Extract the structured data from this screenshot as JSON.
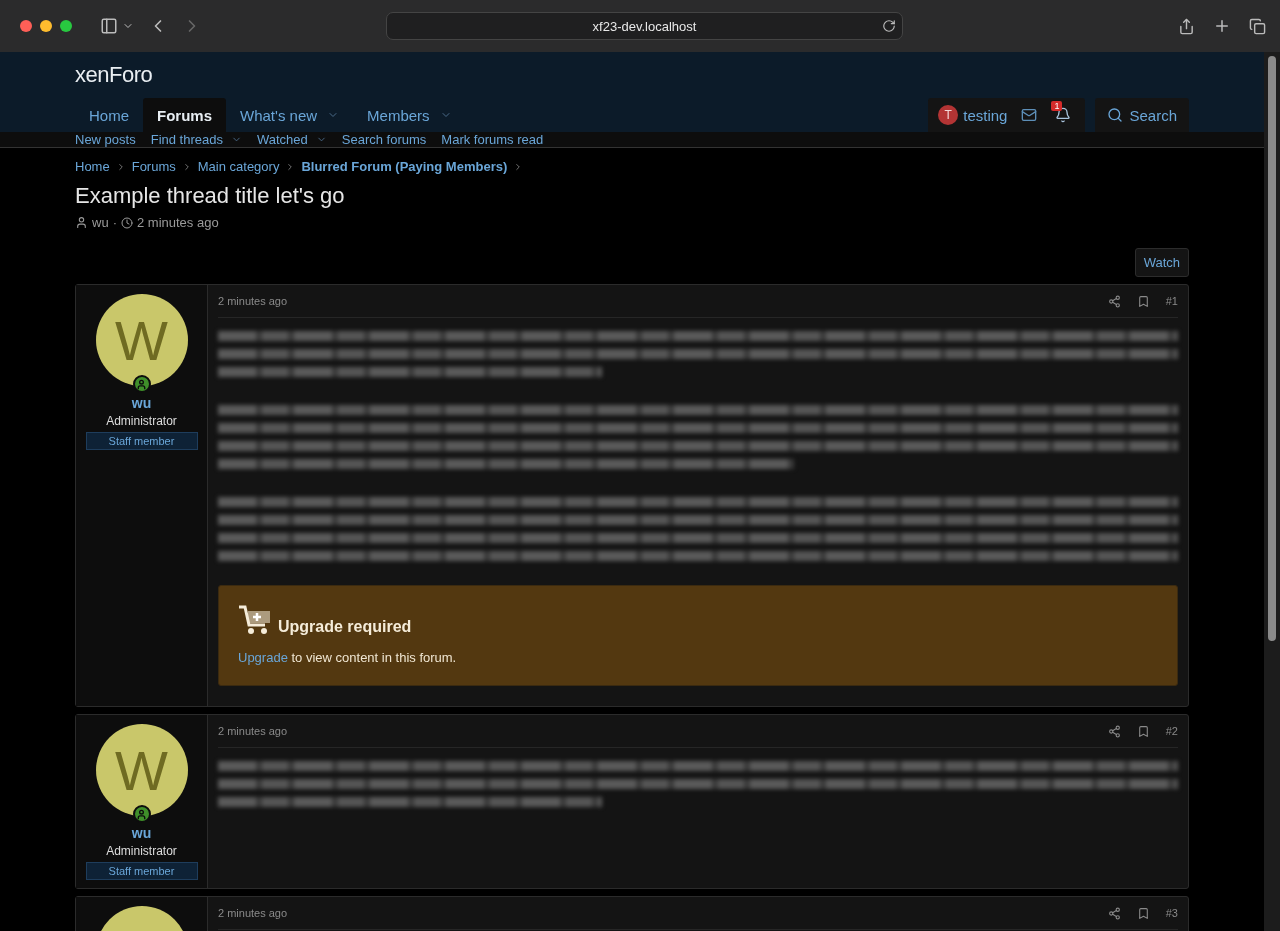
{
  "browser": {
    "url": "xf23-dev.localhost"
  },
  "logo": "xenForo",
  "nav": {
    "tabs": [
      {
        "label": "Home",
        "selected": false,
        "has_menu": false
      },
      {
        "label": "Forums",
        "selected": true,
        "has_menu": false
      },
      {
        "label": "What's new",
        "selected": false,
        "has_menu": true
      },
      {
        "label": "Members",
        "selected": false,
        "has_menu": true
      }
    ],
    "user": {
      "avatar_letter": "T",
      "name": "testing",
      "alert_count": "1"
    },
    "search_label": "Search"
  },
  "subnav": [
    {
      "label": "New posts",
      "has_menu": false
    },
    {
      "label": "Find threads",
      "has_menu": true
    },
    {
      "label": "Watched",
      "has_menu": true
    },
    {
      "label": "Search forums",
      "has_menu": false
    },
    {
      "label": "Mark forums read",
      "has_menu": false
    }
  ],
  "breadcrumbs": [
    {
      "label": "Home",
      "current": false
    },
    {
      "label": "Forums",
      "current": false
    },
    {
      "label": "Main category",
      "current": false
    },
    {
      "label": "Blurred Forum (Paying Members)",
      "current": true
    }
  ],
  "thread": {
    "title": "Example thread title let's go",
    "author": "wu",
    "separator": "·",
    "time": "2 minutes ago"
  },
  "watch_button": "Watch",
  "posts": [
    {
      "avatar_letter": "W",
      "username": "wu",
      "role": "Administrator",
      "banner": "Staff member",
      "online": true,
      "time": "2 minutes ago",
      "number": "#1",
      "notice": {
        "title": "Upgrade required",
        "link": "Upgrade",
        "text": " to view content in this forum."
      }
    },
    {
      "avatar_letter": "W",
      "username": "wu",
      "role": "Administrator",
      "banner": "Staff member",
      "online": true,
      "time": "2 minutes ago",
      "number": "#2"
    },
    {
      "time": "2 minutes ago",
      "number": "#3"
    }
  ]
}
